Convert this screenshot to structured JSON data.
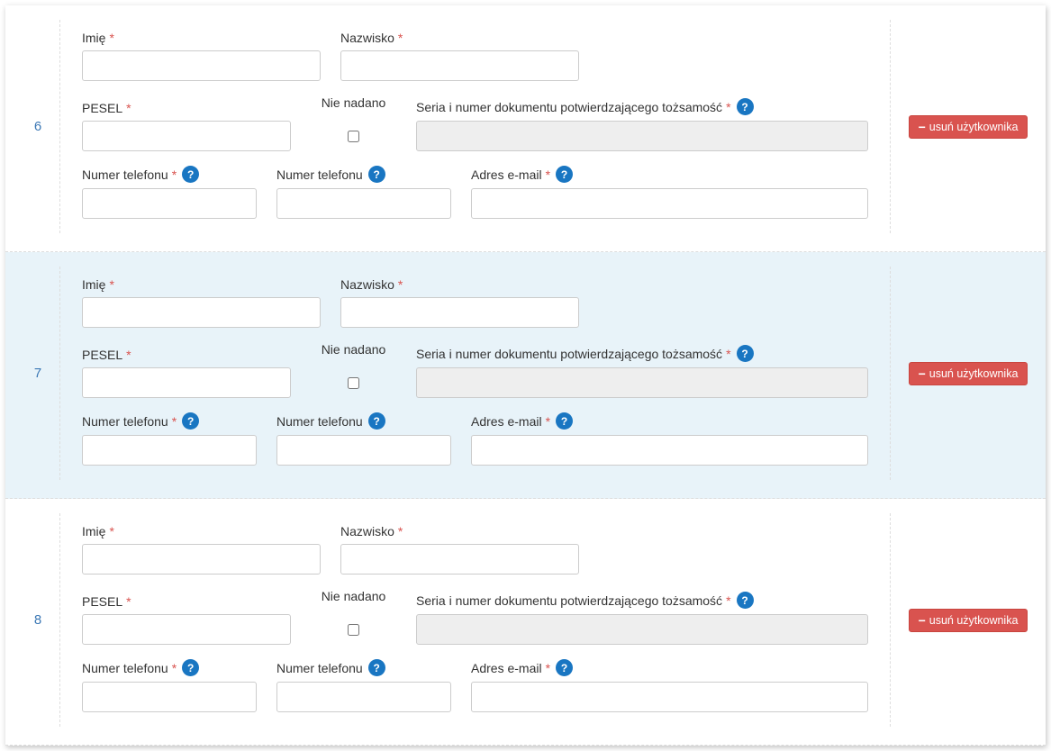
{
  "labels": {
    "firstName": "Imię",
    "lastName": "Nazwisko",
    "pesel": "PESEL",
    "peselNotGiven": "Nie nadano",
    "idDocument": "Seria i numer dokumentu potwierdzającego tożsamość",
    "phone1": "Numer telefonu",
    "phone2": "Numer telefonu",
    "email": "Adres e-mail"
  },
  "required": {
    "firstName": true,
    "lastName": true,
    "pesel": true,
    "peselNotGiven": false,
    "idDocument": true,
    "phone1": true,
    "phone2": false,
    "email": true
  },
  "help": {
    "idDocument": true,
    "phone1": true,
    "phone2": true,
    "email": true
  },
  "deleteLabel": "usuń użytkownika",
  "rows": [
    {
      "index": "6",
      "alt": false
    },
    {
      "index": "7",
      "alt": true
    },
    {
      "index": "8",
      "alt": false
    }
  ]
}
